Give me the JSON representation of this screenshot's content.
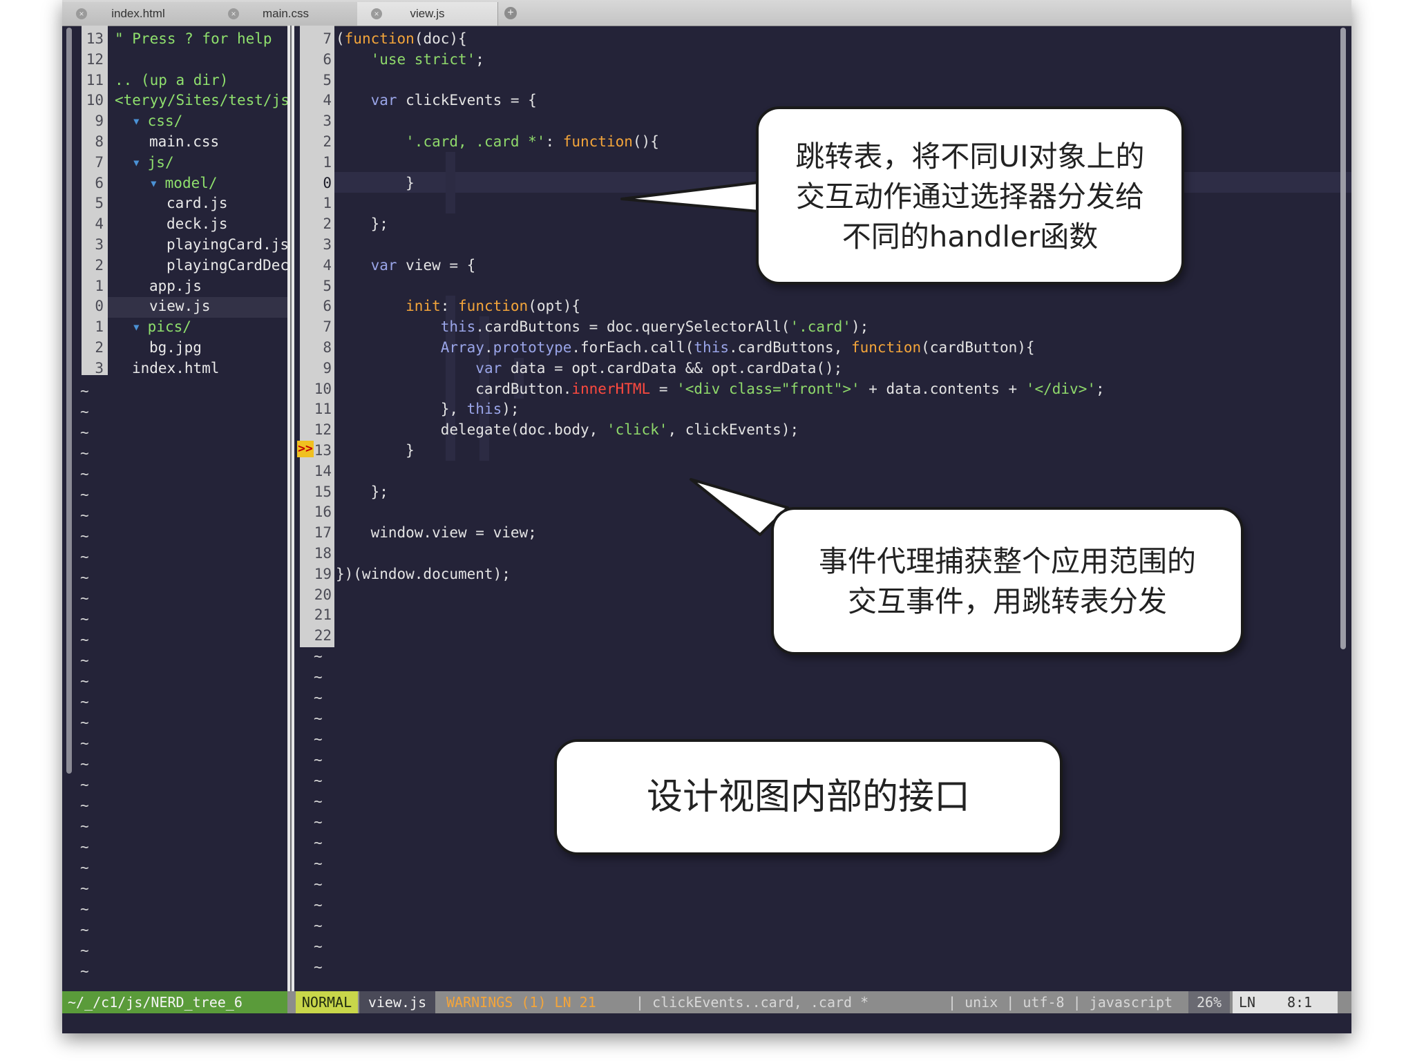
{
  "tabs": [
    {
      "label": "index.html",
      "active": false
    },
    {
      "label": "main.css",
      "active": false
    },
    {
      "label": "view.js",
      "active": true
    }
  ],
  "tree": {
    "rows": [
      {
        "ln": "13",
        "text": "\" Press ? for help"
      },
      {
        "ln": "12",
        "text": ""
      },
      {
        "ln": "11",
        "text": ".. (up a dir)"
      },
      {
        "ln": "10",
        "text": "<teryy/Sites/test/js"
      },
      {
        "ln": "9",
        "arrow": "▾",
        "text": "css/"
      },
      {
        "ln": "8",
        "text": "main.css"
      },
      {
        "ln": "7",
        "arrow": "▾",
        "text": "js/"
      },
      {
        "ln": "6",
        "arrow": "▾",
        "text": "model/"
      },
      {
        "ln": "5",
        "text": "card.js"
      },
      {
        "ln": "4",
        "text": "deck.js"
      },
      {
        "ln": "3",
        "text": "playingCard.js"
      },
      {
        "ln": "2",
        "text": "playingCardDec"
      },
      {
        "ln": "1",
        "text": "app.js"
      },
      {
        "ln": "0",
        "text": "view.js"
      },
      {
        "ln": "1",
        "arrow": "▾",
        "text": "pics/"
      },
      {
        "ln": "2",
        "text": "bg.jpg"
      },
      {
        "ln": "3",
        "text": "index.html"
      }
    ],
    "tilde": "~"
  },
  "editor": {
    "line_numbers": [
      "7",
      "6",
      "5",
      "4",
      "3",
      "2",
      "1",
      "0",
      "1",
      "2",
      "3",
      "4",
      "5",
      "6",
      "7",
      "8",
      "9",
      "10",
      "11",
      "12",
      "13",
      "14",
      "15",
      "16",
      "17",
      "18",
      "19",
      "20",
      "21",
      "22"
    ],
    "sign": ">>",
    "tilde": "~",
    "code": [
      {
        "parts": [
          {
            "t": "(",
            "c": "plain"
          },
          {
            "t": "function",
            "c": "kw"
          },
          {
            "t": "(doc){",
            "c": "plain"
          }
        ]
      },
      {
        "parts": [
          {
            "t": "    ",
            "c": "plain"
          },
          {
            "t": "'use strict'",
            "c": "str"
          },
          {
            "t": ";",
            "c": "plain"
          }
        ]
      },
      {
        "parts": []
      },
      {
        "parts": [
          {
            "t": "    ",
            "c": "plain"
          },
          {
            "t": "var",
            "c": "prop"
          },
          {
            "t": " clickEvents = {",
            "c": "plain"
          }
        ]
      },
      {
        "parts": []
      },
      {
        "parts": [
          {
            "t": "        ",
            "c": "plain"
          },
          {
            "t": "'.card, .card *'",
            "c": "str"
          },
          {
            "t": ": ",
            "c": "plain"
          },
          {
            "t": "function",
            "c": "kw"
          },
          {
            "t": "(){",
            "c": "plain"
          }
        ]
      },
      {
        "parts": []
      },
      {
        "parts": [
          {
            "t": "        }",
            "c": "plain"
          }
        ]
      },
      {
        "parts": []
      },
      {
        "parts": [
          {
            "t": "    };",
            "c": "plain"
          }
        ]
      },
      {
        "parts": []
      },
      {
        "parts": [
          {
            "t": "    ",
            "c": "plain"
          },
          {
            "t": "var",
            "c": "prop"
          },
          {
            "t": " view = {",
            "c": "plain"
          }
        ]
      },
      {
        "parts": []
      },
      {
        "parts": [
          {
            "t": "        ",
            "c": "plain"
          },
          {
            "t": "init",
            "c": "kw"
          },
          {
            "t": ": ",
            "c": "plain"
          },
          {
            "t": "function",
            "c": "kw"
          },
          {
            "t": "(opt){",
            "c": "plain"
          }
        ]
      },
      {
        "parts": [
          {
            "t": "            ",
            "c": "plain"
          },
          {
            "t": "this",
            "c": "prop"
          },
          {
            "t": ".cardButtons = doc.querySelectorAll(",
            "c": "plain"
          },
          {
            "t": "'.card'",
            "c": "str"
          },
          {
            "t": ");",
            "c": "plain"
          }
        ]
      },
      {
        "parts": [
          {
            "t": "            ",
            "c": "plain"
          },
          {
            "t": "Array",
            "c": "prop"
          },
          {
            "t": ".",
            "c": "plain"
          },
          {
            "t": "prototype",
            "c": "prop"
          },
          {
            "t": ".forEach.call(",
            "c": "plain"
          },
          {
            "t": "this",
            "c": "prop"
          },
          {
            "t": ".cardButtons, ",
            "c": "plain"
          },
          {
            "t": "function",
            "c": "kw"
          },
          {
            "t": "(cardButton){",
            "c": "plain"
          }
        ]
      },
      {
        "parts": [
          {
            "t": "                ",
            "c": "plain"
          },
          {
            "t": "var",
            "c": "prop"
          },
          {
            "t": " data = opt.cardData && opt.cardData();",
            "c": "plain"
          }
        ]
      },
      {
        "parts": [
          {
            "t": "                cardButton.",
            "c": "plain"
          },
          {
            "t": "innerHTML",
            "c": "err"
          },
          {
            "t": " = ",
            "c": "plain"
          },
          {
            "t": "'<div class=\"front\">'",
            "c": "str"
          },
          {
            "t": " + data.contents + ",
            "c": "plain"
          },
          {
            "t": "'</div>'",
            "c": "str"
          },
          {
            "t": ";",
            "c": "plain"
          }
        ]
      },
      {
        "parts": [
          {
            "t": "            }, ",
            "c": "plain"
          },
          {
            "t": "this",
            "c": "prop"
          },
          {
            "t": ");",
            "c": "plain"
          }
        ]
      },
      {
        "parts": [
          {
            "t": "            delegate(doc.body, ",
            "c": "plain"
          },
          {
            "t": "'click'",
            "c": "str"
          },
          {
            "t": ", clickEvents);",
            "c": "plain"
          }
        ]
      },
      {
        "parts": [
          {
            "t": "        }",
            "c": "plain"
          }
        ]
      },
      {
        "parts": []
      },
      {
        "parts": [
          {
            "t": "    };",
            "c": "plain"
          }
        ]
      },
      {
        "parts": []
      },
      {
        "parts": [
          {
            "t": "    window.view = view;",
            "c": "plain"
          }
        ]
      },
      {
        "parts": []
      },
      {
        "parts": [
          {
            "t": "})(window.document);",
            "c": "plain"
          }
        ]
      },
      {
        "parts": []
      },
      {
        "parts": []
      }
    ]
  },
  "status": {
    "tree_path": "~/_/c1/js/NERD_tree_6",
    "mode": "NORMAL",
    "file": "view.js",
    "warnings": "WARNINGS (1) LN 21",
    "context": "| clickEvents..card, .card *",
    "format": "| unix | utf-8 | javascript",
    "percent": "26%",
    "ln_label": "LN",
    "position": "8:1"
  },
  "callouts": {
    "jump_table": [
      "跳转表，将不同UI对象上的",
      "交互动作通过选择器分发给",
      "不同的handler函数"
    ],
    "delegation": [
      "事件代理捕获整个应用范围的",
      "交互事件，用跳转表分发"
    ],
    "interface": "设计视图内部的接口"
  },
  "colors": {
    "editor_bg": "#242338",
    "status_bg": "#8c8c8c",
    "tree_path_bg": "#5a9b3a",
    "mode_bg": "#c8d64a",
    "warning_fg": "#f4a53a",
    "string": "#8fd96b",
    "keyword": "#f4a53a"
  }
}
